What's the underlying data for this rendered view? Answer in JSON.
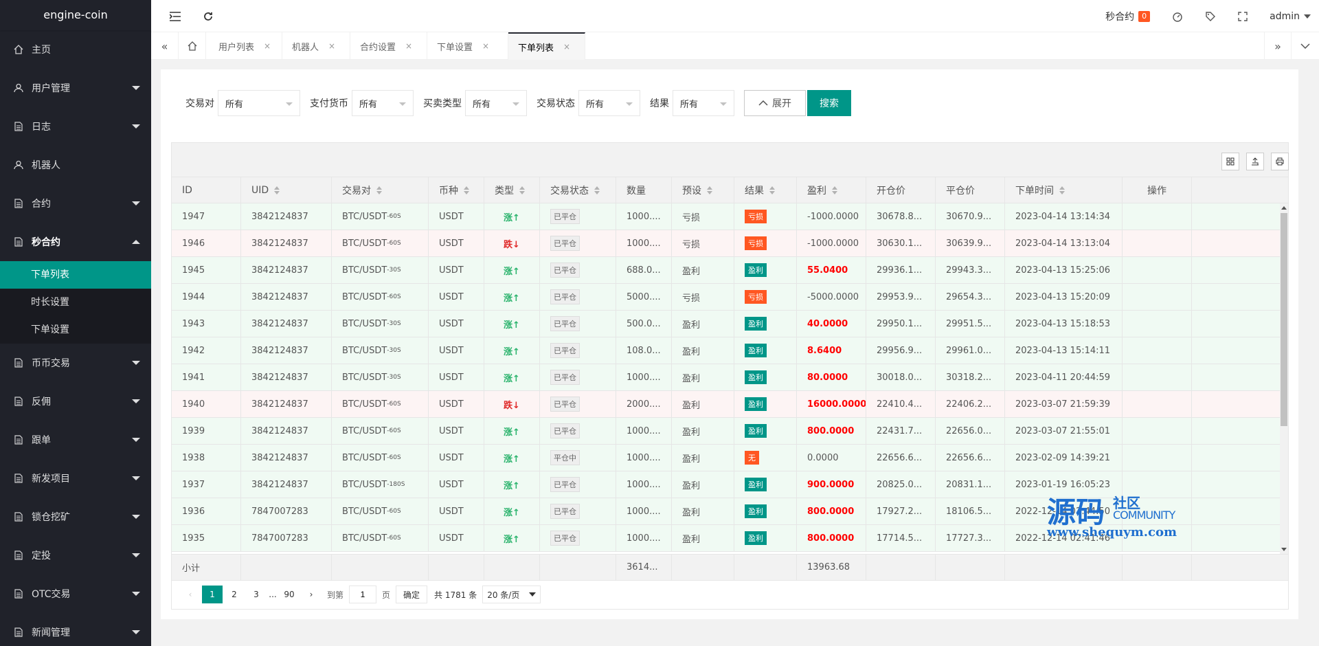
{
  "app": {
    "title": "engine-coin"
  },
  "sidebar": {
    "items": [
      {
        "label": "主页",
        "icon": "home-icon",
        "caret": "none"
      },
      {
        "label": "用户管理",
        "icon": "user-icon",
        "caret": "down"
      },
      {
        "label": "日志",
        "icon": "doc-icon",
        "caret": "down"
      },
      {
        "label": "机器人",
        "icon": "user-icon",
        "caret": "none"
      },
      {
        "label": "合约",
        "icon": "doc-icon",
        "caret": "down"
      },
      {
        "label": "秒合约",
        "icon": "doc-icon",
        "caret": "up"
      }
    ],
    "subitems": [
      "下单列表",
      "时长设置",
      "下单设置"
    ],
    "items_after": [
      {
        "label": "币币交易",
        "icon": "doc-icon"
      },
      {
        "label": "反佣",
        "icon": "doc-icon"
      },
      {
        "label": "跟单",
        "icon": "doc-icon"
      },
      {
        "label": "新发项目",
        "icon": "doc-icon"
      },
      {
        "label": "锁仓挖矿",
        "icon": "doc-icon"
      },
      {
        "label": "定投",
        "icon": "doc-icon"
      },
      {
        "label": "OTC交易",
        "icon": "doc-icon"
      },
      {
        "label": "新闻管理",
        "icon": "doc-icon"
      }
    ]
  },
  "header": {
    "notice_label": "秒合约",
    "notice_count": "0",
    "user": "admin"
  },
  "tabs": [
    "用户列表",
    "机器人",
    "合约设置",
    "下单设置",
    "下单列表"
  ],
  "filters": {
    "pair_label": "交易对",
    "pair_value": "所有",
    "currency_label": "支付货币",
    "currency_value": "所有",
    "type_label": "买卖类型",
    "type_value": "所有",
    "status_label": "交易状态",
    "status_value": "所有",
    "result_label": "结果",
    "result_value": "所有",
    "expand_label": "展开",
    "search_label": "搜索"
  },
  "table": {
    "headers": [
      "ID",
      "UID",
      "交易对",
      "币种",
      "类型",
      "交易状态",
      "数量",
      "预设",
      "结果",
      "盈利",
      "开仓价",
      "平仓价",
      "下单时间",
      "操作"
    ],
    "rows": [
      {
        "id": "1947",
        "uid": "3842124837",
        "pair": "BTC/USDT",
        "period": "-60S",
        "coin": "USDT",
        "dir": "up",
        "type": "涨↑",
        "status": "已平仓",
        "qty": "1000....",
        "preset": "亏损",
        "result": "亏损",
        "rclass": "loss",
        "profit": "-1000.0000",
        "pred": false,
        "open": "30678.8...",
        "close": "30670.9...",
        "time": "2023-04-14 13:14:34"
      },
      {
        "id": "1946",
        "uid": "3842124837",
        "pair": "BTC/USDT",
        "period": "-60S",
        "coin": "USDT",
        "dir": "down",
        "type": "跌↓",
        "status": "已平仓",
        "qty": "1000....",
        "preset": "亏损",
        "result": "亏损",
        "rclass": "loss",
        "profit": "-1000.0000",
        "pred": false,
        "open": "30630.1...",
        "close": "30639.9...",
        "time": "2023-04-14 13:13:04"
      },
      {
        "id": "1945",
        "uid": "3842124837",
        "pair": "BTC/USDT",
        "period": "-30S",
        "coin": "USDT",
        "dir": "up",
        "type": "涨↑",
        "status": "已平仓",
        "qty": "688.0...",
        "preset": "盈利",
        "result": "盈利",
        "rclass": "win",
        "profit": "55.0400",
        "pred": true,
        "open": "29936.1...",
        "close": "29943.3...",
        "time": "2023-04-13 15:25:06"
      },
      {
        "id": "1944",
        "uid": "3842124837",
        "pair": "BTC/USDT",
        "period": "-60S",
        "coin": "USDT",
        "dir": "up",
        "type": "涨↑",
        "status": "已平仓",
        "qty": "5000....",
        "preset": "亏损",
        "result": "亏损",
        "rclass": "loss",
        "profit": "-5000.0000",
        "pred": false,
        "open": "29953.9...",
        "close": "29654.3...",
        "time": "2023-04-13 15:20:09"
      },
      {
        "id": "1943",
        "uid": "3842124837",
        "pair": "BTC/USDT",
        "period": "-30S",
        "coin": "USDT",
        "dir": "up",
        "type": "涨↑",
        "status": "已平仓",
        "qty": "500.0...",
        "preset": "盈利",
        "result": "盈利",
        "rclass": "win",
        "profit": "40.0000",
        "pred": true,
        "open": "29950.1...",
        "close": "29951.5...",
        "time": "2023-04-13 15:18:53"
      },
      {
        "id": "1942",
        "uid": "3842124837",
        "pair": "BTC/USDT",
        "period": "-30S",
        "coin": "USDT",
        "dir": "up",
        "type": "涨↑",
        "status": "已平仓",
        "qty": "108.0...",
        "preset": "盈利",
        "result": "盈利",
        "rclass": "win",
        "profit": "8.6400",
        "pred": true,
        "open": "29956.9...",
        "close": "29961.0...",
        "time": "2023-04-13 15:14:11"
      },
      {
        "id": "1941",
        "uid": "3842124837",
        "pair": "BTC/USDT",
        "period": "-30S",
        "coin": "USDT",
        "dir": "up",
        "type": "涨↑",
        "status": "已平仓",
        "qty": "1000....",
        "preset": "盈利",
        "result": "盈利",
        "rclass": "win",
        "profit": "80.0000",
        "pred": true,
        "open": "30018.0...",
        "close": "30318.2...",
        "time": "2023-04-11 20:44:59"
      },
      {
        "id": "1940",
        "uid": "3842124837",
        "pair": "BTC/USDT",
        "period": "-60S",
        "coin": "USDT",
        "dir": "down",
        "type": "跌↓",
        "status": "已平仓",
        "qty": "2000....",
        "preset": "盈利",
        "result": "盈利",
        "rclass": "win",
        "profit": "16000.0000",
        "pred": true,
        "open": "22410.4...",
        "close": "22406.2...",
        "time": "2023-03-07 21:59:39"
      },
      {
        "id": "1939",
        "uid": "3842124837",
        "pair": "BTC/USDT",
        "period": "-60S",
        "coin": "USDT",
        "dir": "up",
        "type": "涨↑",
        "status": "已平仓",
        "qty": "1000....",
        "preset": "盈利",
        "result": "盈利",
        "rclass": "win",
        "profit": "800.0000",
        "pred": true,
        "open": "22431.7...",
        "close": "22656.0...",
        "time": "2023-03-07 21:55:01"
      },
      {
        "id": "1938",
        "uid": "3842124837",
        "pair": "BTC/USDT",
        "period": "-60S",
        "coin": "USDT",
        "dir": "up",
        "type": "涨↑",
        "status": "平仓中",
        "qty": "1000....",
        "preset": "盈利",
        "result": "无",
        "rclass": "none",
        "profit": "0.0000",
        "pred": false,
        "open": "22656.6...",
        "close": "22656.6...",
        "time": "2023-02-09 14:39:21"
      },
      {
        "id": "1937",
        "uid": "3842124837",
        "pair": "BTC/USDT",
        "period": "-180S",
        "coin": "USDT",
        "dir": "up",
        "type": "涨↑",
        "status": "已平仓",
        "qty": "1000....",
        "preset": "盈利",
        "result": "盈利",
        "rclass": "win",
        "profit": "900.0000",
        "pred": true,
        "open": "20825.0...",
        "close": "20831.1...",
        "time": "2023-01-19 16:05:23"
      },
      {
        "id": "1936",
        "uid": "7847007283",
        "pair": "BTC/USDT",
        "period": "-60S",
        "coin": "USDT",
        "dir": "up",
        "type": "涨↑",
        "status": "已平仓",
        "qty": "1000....",
        "preset": "盈利",
        "result": "盈利",
        "rclass": "win",
        "profit": "800.0000",
        "pred": true,
        "open": "17927.2...",
        "close": "18106.5...",
        "time": "2022-12-14 02:44:50"
      },
      {
        "id": "1935",
        "uid": "7847007283",
        "pair": "BTC/USDT",
        "period": "-60S",
        "coin": "USDT",
        "dir": "up",
        "type": "涨↑",
        "status": "已平仓",
        "qty": "1000....",
        "preset": "盈利",
        "result": "盈利",
        "rclass": "win",
        "profit": "800.0000",
        "pred": true,
        "open": "17714.5...",
        "close": "17727.3...",
        "time": "2022-12-14 02:41:46"
      }
    ],
    "subtotal": {
      "label": "小计",
      "qty": "3614...",
      "profit": "13963.68"
    }
  },
  "pager": {
    "pages": [
      "1",
      "2",
      "3",
      "...",
      "90"
    ],
    "goto_label": "到第",
    "goto_value": "1",
    "page_unit": "页",
    "confirm": "确定",
    "total": "共 1781 条",
    "per_page": "20 条/页"
  },
  "watermark": {
    "big": "源码",
    "sq": "社区",
    "comm": "COMMUNITY",
    "url": "www.shequym.com"
  }
}
